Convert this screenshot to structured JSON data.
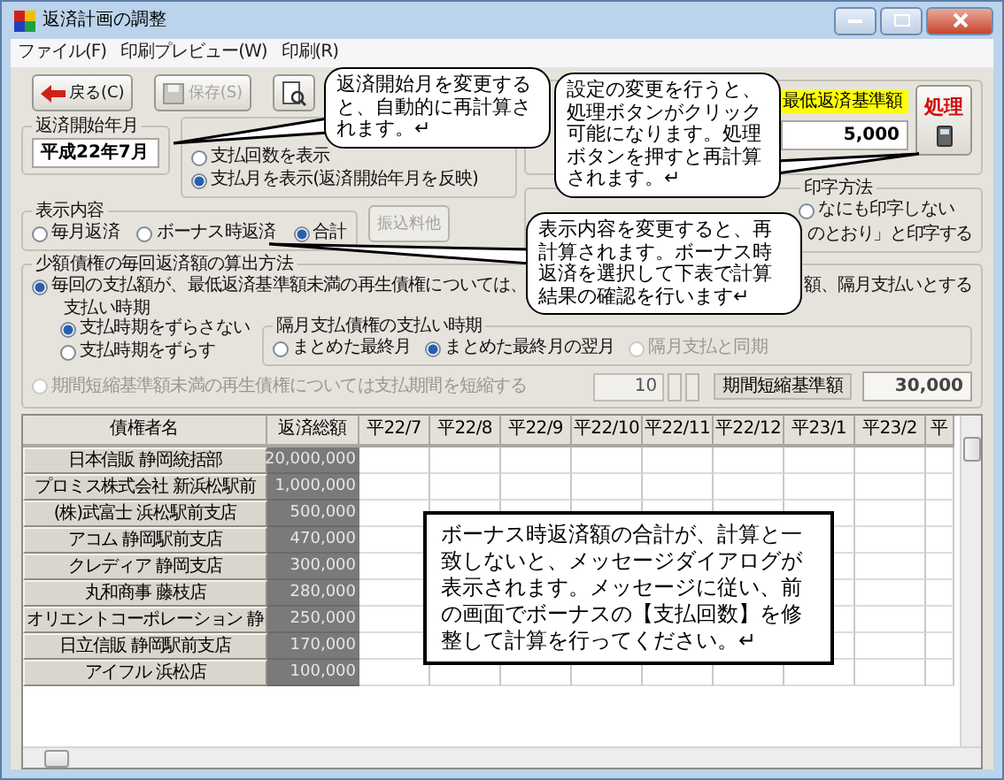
{
  "window": {
    "title": "返済計画の調整"
  },
  "menu": [
    "ファイル(F)",
    "印刷プレビュー(W)",
    "印刷(R)"
  ],
  "toolbar": [
    {
      "kind": "back",
      "label": "戻る(C)",
      "disabled": false
    },
    {
      "kind": "save",
      "label": "保存(S)",
      "disabled": true
    },
    {
      "kind": "preview",
      "disabled": false
    }
  ],
  "start_month": {
    "label": "返済開始年月",
    "value": "平成22年7月"
  },
  "payment_display": {
    "options": [
      {
        "label": "支払回数を表示",
        "selected": false
      },
      {
        "label": "支払月を表示(返済開始年月を反映)",
        "selected": true
      }
    ]
  },
  "minimum": {
    "label": "最低返済基準額",
    "value": "5,000"
  },
  "process_button": {
    "label": "処理"
  },
  "print_method": {
    "legend": "印字方法",
    "options": [
      {
        "label": "なにも印字しない",
        "selected": false
      }
    ],
    "note": "のとおり」と印字する"
  },
  "display_content": {
    "label": "表示内容",
    "options": [
      {
        "label": "毎月返済",
        "selected": false
      },
      {
        "label": "ボーナス時返済",
        "selected": false
      },
      {
        "label": "合計",
        "selected": true
      }
    ],
    "extra_button": {
      "label": "振込料他",
      "disabled": true
    }
  },
  "small_claims": {
    "label": "少額債権の毎回返済額の算出方法",
    "option": {
      "label": "毎回の支払額が、最低返済基準額未満の再生債権については、",
      "selected": true
    },
    "option_tail": "額、隔月支払いとする",
    "timing": {
      "label": "支払い時期",
      "options": [
        {
          "label": "支払時期をずらさない",
          "selected": true
        },
        {
          "label": "支払時期をずらす",
          "selected": false
        }
      ]
    },
    "bimonthly": {
      "label": "隔月支払債権の支払い時期",
      "options": [
        {
          "label": "まとめた最終月",
          "selected": false,
          "disabled": false
        },
        {
          "label": "まとめた最終月の翌月",
          "selected": true,
          "disabled": false
        },
        {
          "label": "隔月支払と同期",
          "selected": false,
          "disabled": true
        }
      ]
    },
    "shorten": {
      "label": "期間短縮基準額未満の再生債権については支払期間を短縮する",
      "checked": false,
      "disabled": true,
      "months": "10",
      "amount_label": "期間短縮基準額",
      "amount": "30,000"
    }
  },
  "table": {
    "columns": [
      "債権者名",
      "返済総額",
      "平22/7",
      "平22/8",
      "平22/9",
      "平22/10",
      "平22/11",
      "平22/12",
      "平23/1",
      "平23/2",
      "平"
    ],
    "rows": [
      {
        "name": "日本信販 静岡統括部",
        "total": "20,000,000"
      },
      {
        "name": "プロミス株式会社 新浜松駅前",
        "total": "1,000,000"
      },
      {
        "name": "(株)武富士 浜松駅前支店",
        "total": "500,000"
      },
      {
        "name": "アコム 静岡駅前支店",
        "total": "470,000"
      },
      {
        "name": "クレディア 静岡支店",
        "total": "300,000"
      },
      {
        "name": "丸和商事 藤枝店",
        "total": "280,000"
      },
      {
        "name": "オリエントコーポレーション 静",
        "total": "250,000"
      },
      {
        "name": "日立信販 静岡駅前支店",
        "total": "170,000"
      },
      {
        "name": "アイフル 浜松店",
        "total": "100,000"
      }
    ]
  },
  "callouts": [
    {
      "kind": "bubble",
      "text": "返済開始月を変更すると、自動的に再計算されます。↵"
    },
    {
      "kind": "bubble",
      "text": "設定の変更を行うと、処理ボタンがクリック可能になります。処理ボタンを押すと再計算されます。↵"
    },
    {
      "kind": "bubble",
      "text": "表示内容を変更すると、再計算されます。ボーナス時返済を選択して下表で計算結果の確認を行います↵"
    },
    {
      "kind": "box",
      "text": "ボーナス時返済額の合計が、計算と一致しないと、メッセージダイアログが表示されます。メッセージに従い、前の画面でボーナスの【支払回数】を修整して計算を行ってください。↵"
    }
  ]
}
